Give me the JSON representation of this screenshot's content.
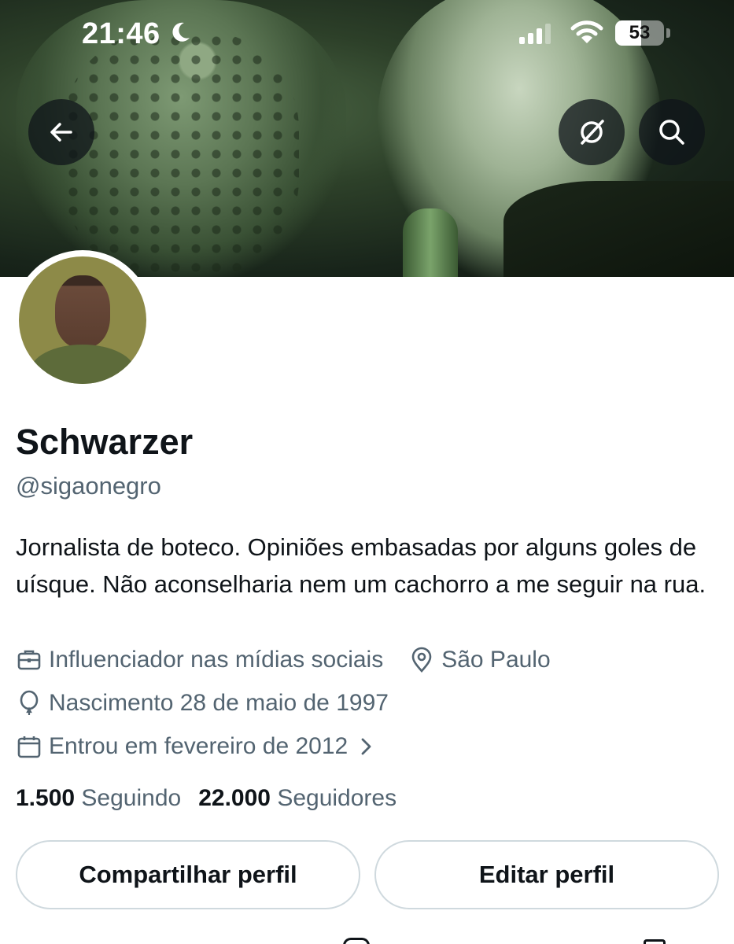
{
  "status_bar": {
    "time": "21:46",
    "battery": "53",
    "battery_level": 0.53,
    "icons": [
      "moon-icon",
      "signal-icon",
      "wifi-icon",
      "battery-icon"
    ]
  },
  "header": {
    "buttons": [
      "back-arrow-icon",
      "grok-icon",
      "search-icon"
    ]
  },
  "profile": {
    "display_name": "Schwarzer",
    "handle": "@sigaonegro",
    "bio": "Jornalista de boteco. Opiniões embasadas por alguns goles de uísque. Não aconselharia nem um cachorro a me seguir na rua.",
    "category": "Influenciador nas mídias sociais",
    "location": "São Paulo",
    "birth": "Nascimento 28 de maio de 1997",
    "joined": "Entrou em fevereiro de 2012",
    "following_count": "1.500",
    "following_label": "Seguindo",
    "followers_count": "22.000",
    "followers_label": "Seguidores"
  },
  "actions": {
    "share_label": "Compartilhar perfil",
    "edit_label": "Editar perfil"
  },
  "colors": {
    "text": "#0f1419",
    "secondary": "#536471",
    "border": "#cfd9de"
  }
}
